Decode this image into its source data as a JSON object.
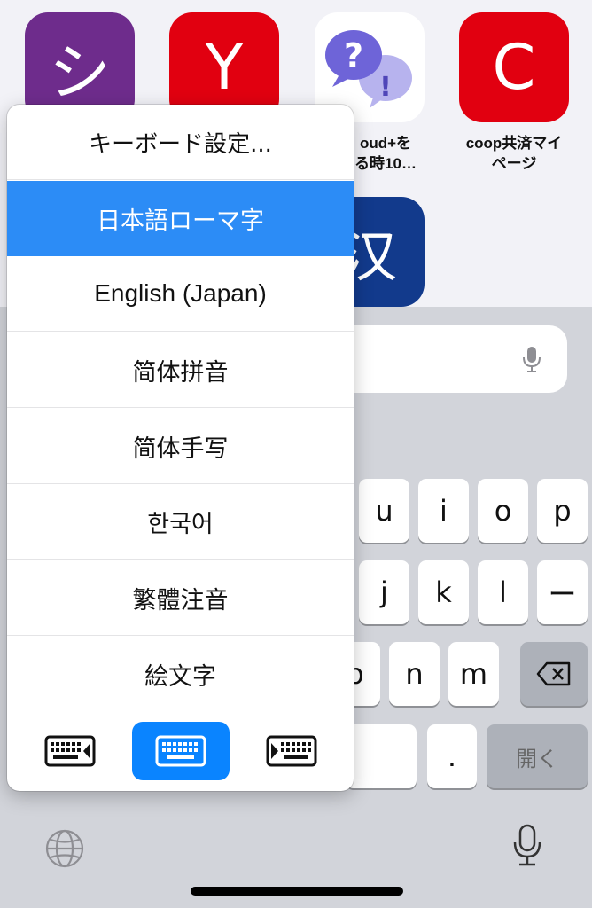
{
  "apps": [
    {
      "glyph": "シ",
      "color": "#6e2c8c",
      "caption": ""
    },
    {
      "glyph": "Y",
      "color": "#e10010",
      "caption": ""
    },
    {
      "glyph": "",
      "color": "#ffffff",
      "caption_line1": "oud+を",
      "caption_line2": "る時10…"
    },
    {
      "glyph": "C",
      "color": "#e10010",
      "caption_line1": "coop共済マイ",
      "caption_line2": "ページ"
    },
    {
      "glyph": "汉",
      "color": "#123a8c",
      "caption": ""
    }
  ],
  "keyboard_menu": {
    "settings": "キーボード設定...",
    "items": [
      {
        "label": "日本語ローマ字",
        "selected": true
      },
      {
        "label": "English (Japan)",
        "selected": false
      },
      {
        "label": "简体拼音",
        "selected": false
      },
      {
        "label": "简体手写",
        "selected": false
      },
      {
        "label": "한국어",
        "selected": false
      },
      {
        "label": "繁體注音",
        "selected": false
      },
      {
        "label": "絵文字",
        "selected": false
      }
    ],
    "layout_buttons": [
      "keyboard-left-icon",
      "keyboard-full-icon",
      "keyboard-right-icon"
    ],
    "accent": "#0a84ff",
    "selected_color": "#2c8cf6"
  },
  "keys": {
    "row1": [
      "u",
      "i",
      "o",
      "p"
    ],
    "row2": [
      "j",
      "k",
      "l",
      "ー"
    ],
    "row3": [
      "b",
      "n",
      "m"
    ],
    "period": ".",
    "open": "開く"
  }
}
